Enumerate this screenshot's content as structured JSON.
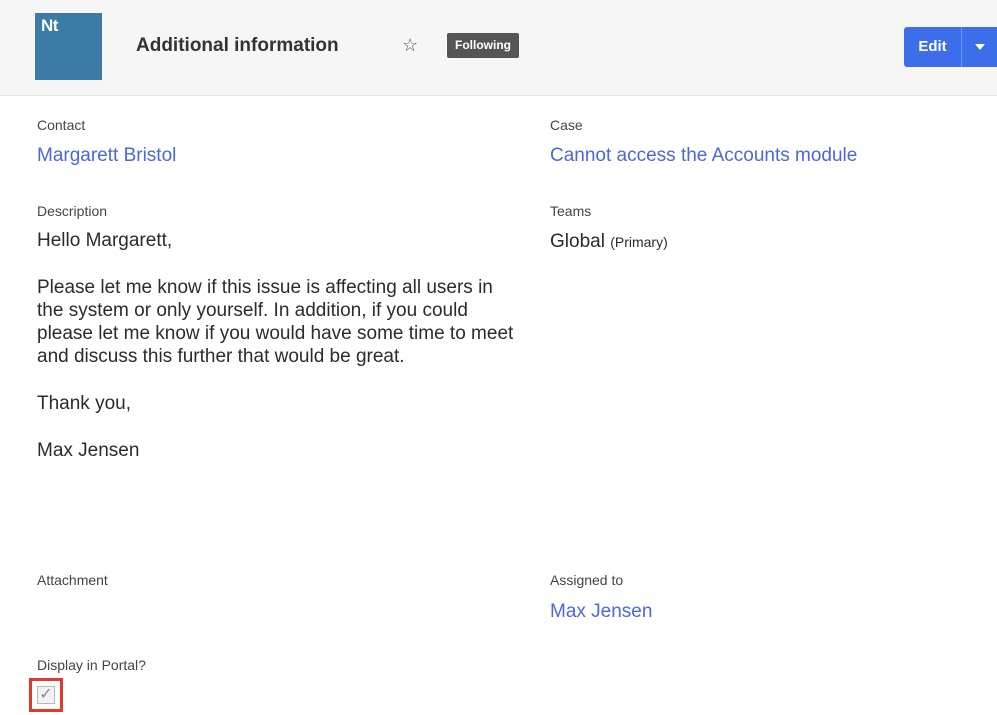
{
  "header": {
    "module_abbrev": "Nt",
    "title": "Additional information",
    "star_glyph": "☆",
    "following_label": "Following",
    "edit_label": "Edit"
  },
  "fields": {
    "contact": {
      "label": "Contact",
      "value": "Margarett Bristol"
    },
    "case": {
      "label": "Case",
      "value": "Cannot access the Accounts module"
    },
    "description": {
      "label": "Description",
      "paragraphs": [
        "Hello Margarett,",
        "Please let me know if this issue is affecting all users in the system or only yourself. In addition, if you could please let me know if you would have some time to meet and discuss this further that would be great.",
        "Thank you,",
        "Max Jensen"
      ]
    },
    "teams": {
      "label": "Teams",
      "value": "Global",
      "tag": "(Primary)"
    },
    "attachment": {
      "label": "Attachment"
    },
    "assigned_to": {
      "label": "Assigned to",
      "value": "Max Jensen"
    },
    "display_in_portal": {
      "label": "Display in Portal?",
      "checked": true,
      "check_glyph": "✓"
    }
  },
  "colors": {
    "accent": "#3b6ee8",
    "link": "#4a67e0",
    "module_badge": "#3c7ba5",
    "highlight": "#e23a2a"
  }
}
